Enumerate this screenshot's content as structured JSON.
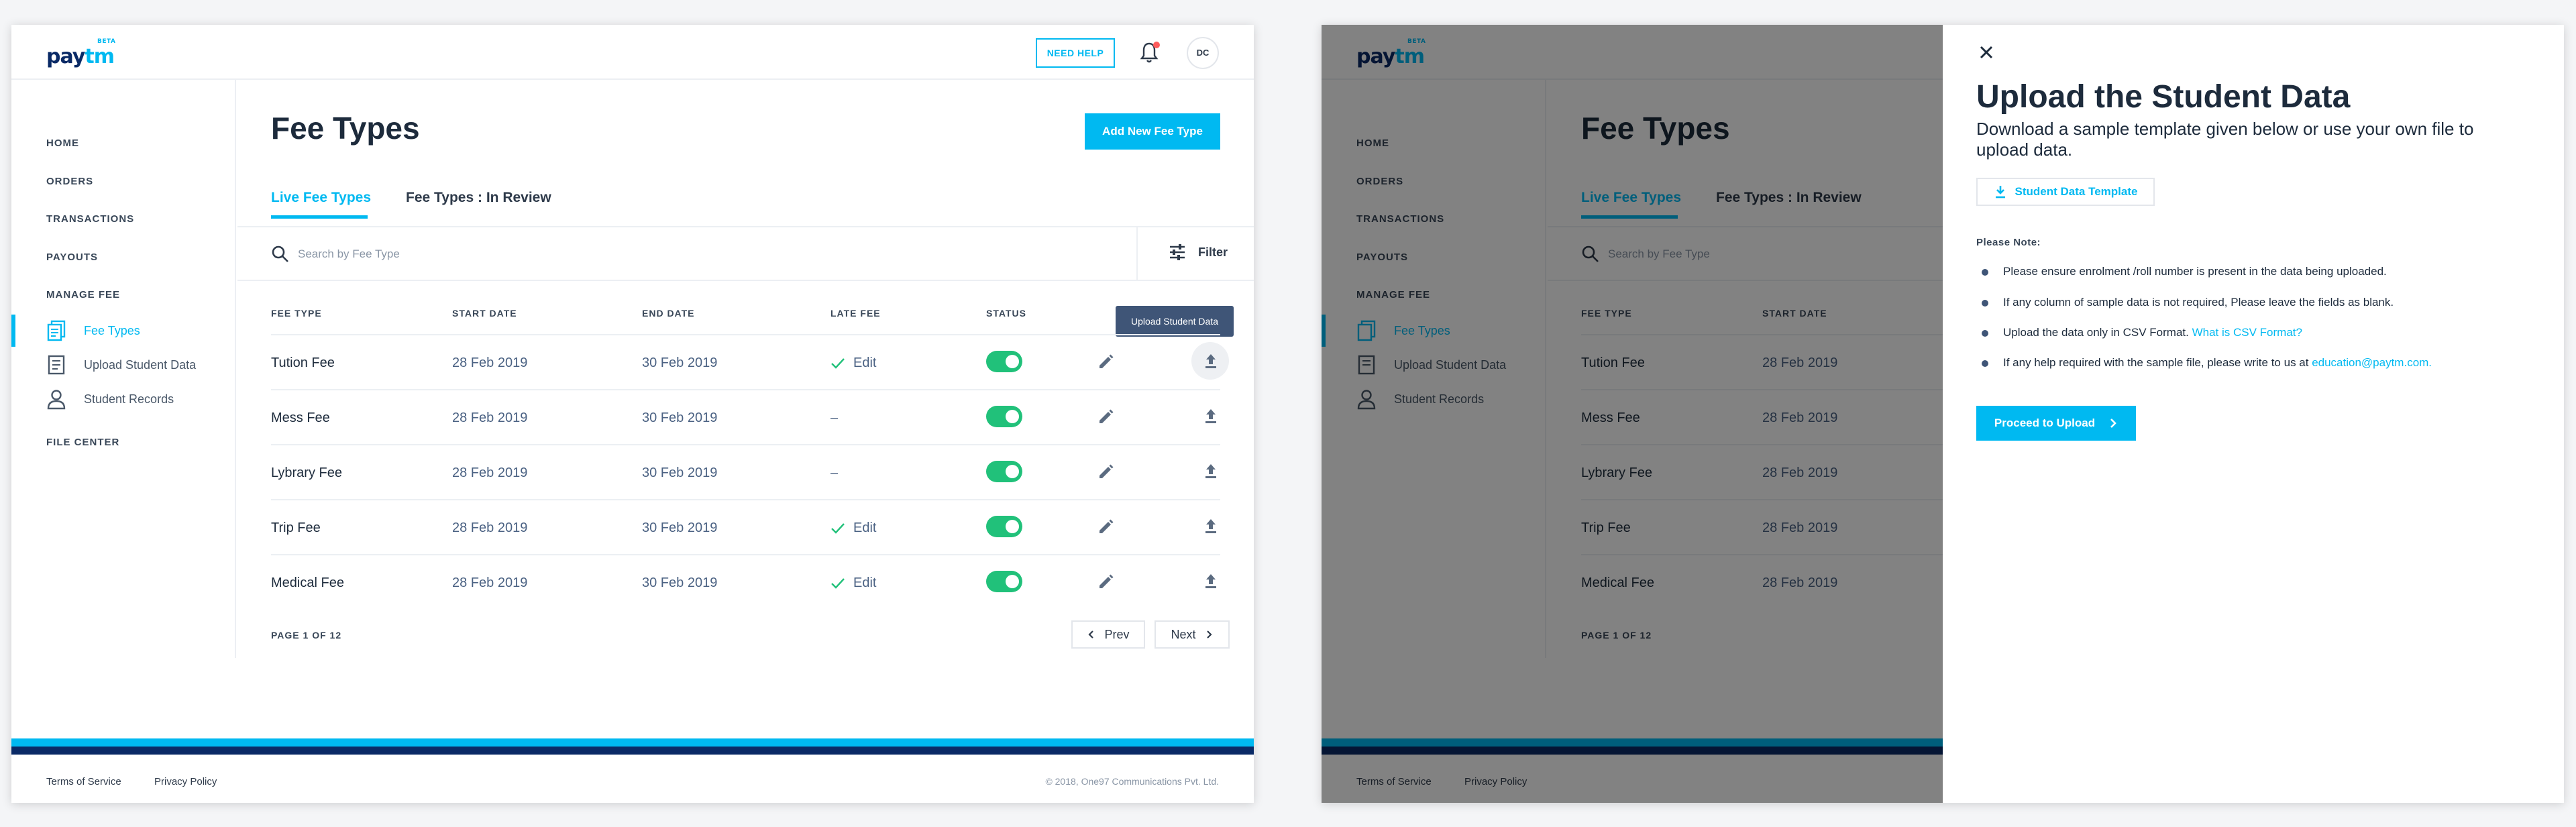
{
  "brand": {
    "pay": "pay",
    "tm": "tm",
    "beta": "BETA"
  },
  "header": {
    "need_help": "NEED HELP",
    "avatar_initials": "DC"
  },
  "sidebar": {
    "items": [
      {
        "label": "HOME"
      },
      {
        "label": "ORDERS"
      },
      {
        "label": "TRANSACTIONS"
      },
      {
        "label": "PAYOUTS"
      },
      {
        "label": "MANAGE FEE"
      }
    ],
    "manage_fee_items": [
      {
        "label": "Fee Types",
        "icon": "document-copy-icon",
        "active": true
      },
      {
        "label": "Upload Student Data",
        "icon": "document-list-icon",
        "active": false
      },
      {
        "label": "Student Records",
        "icon": "person-icon",
        "active": false
      }
    ],
    "file_center": "FILE CENTER"
  },
  "main": {
    "title": "Fee Types",
    "add_button": "Add New Fee Type",
    "tabs": [
      {
        "label": "Live Fee Types",
        "active": true
      },
      {
        "label": "Fee Types : In Review",
        "active": false
      }
    ],
    "search_placeholder": "Search by Fee Type",
    "filter_label": "Filter"
  },
  "table": {
    "headers": [
      "FEE TYPE",
      "START DATE",
      "END DATE",
      "LATE FEE",
      "STATUS"
    ],
    "rows": [
      {
        "fee_type": "Tution Fee",
        "start_date": "28 Feb 2019",
        "end_date": "30 Feb 2019",
        "late_fee": "Edit",
        "late_fee_set": true,
        "status_on": true
      },
      {
        "fee_type": "Mess Fee",
        "start_date": "28 Feb 2019",
        "end_date": "30 Feb 2019",
        "late_fee": "–",
        "late_fee_set": false,
        "status_on": true
      },
      {
        "fee_type": "Lybrary Fee",
        "start_date": "28 Feb 2019",
        "end_date": "30 Feb 2019",
        "late_fee": "–",
        "late_fee_set": false,
        "status_on": true
      },
      {
        "fee_type": "Trip Fee",
        "start_date": "28 Feb 2019",
        "end_date": "30 Feb 2019",
        "late_fee": "Edit",
        "late_fee_set": true,
        "status_on": true
      },
      {
        "fee_type": "Medical Fee",
        "start_date": "28 Feb 2019",
        "end_date": "30 Feb 2019",
        "late_fee": "Edit",
        "late_fee_set": true,
        "status_on": true
      }
    ],
    "tooltip": "Upload Student Data"
  },
  "pagination": {
    "info": "PAGE 1 OF 12",
    "prev": "Prev",
    "next": "Next"
  },
  "footer": {
    "terms": "Terms of Service",
    "privacy": "Privacy Policy",
    "copyright": "© 2018, One97 Communications Pvt. Ltd."
  },
  "drawer": {
    "title": "Upload the Student Data",
    "subtitle": "Download a sample template given below or use your own file to upload data.",
    "template_button": "Student Data Template",
    "note_label": "Please Note:",
    "notes": [
      {
        "text": "Please ensure enrolment /roll number is present in the data being uploaded.",
        "link": ""
      },
      {
        "text": "If any column of sample data is not required, Please leave the fields as blank.",
        "link": ""
      },
      {
        "text": "Upload the data only in CSV Format. ",
        "link": "What is CSV Format?"
      },
      {
        "text": "If any help required with the sample file, please write to us at ",
        "link": "education@paytm.com."
      }
    ],
    "proceed_button": "Proceed to Upload"
  },
  "colors": {
    "accent": "#00b9f1",
    "brand_dark": "#0a2a66",
    "toggle_on": "#21c17a",
    "tooltip": "#3f5577",
    "notification": "#fd5c5c"
  }
}
